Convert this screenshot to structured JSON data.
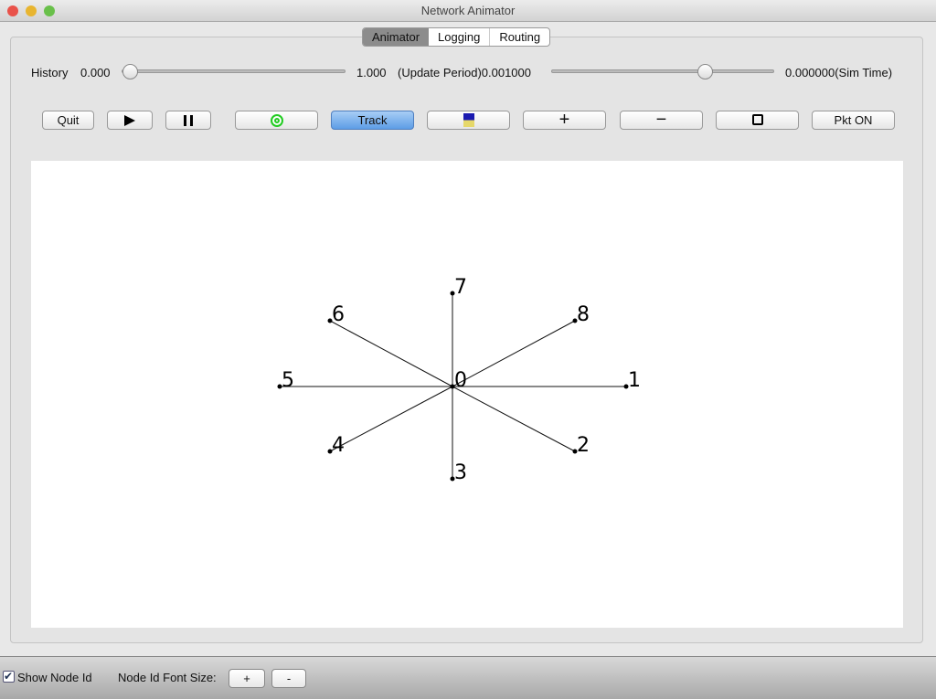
{
  "window": {
    "title": "Network Animator"
  },
  "tabs": [
    {
      "label": "Animator",
      "active": true
    },
    {
      "label": "Logging"
    },
    {
      "label": "Routing"
    }
  ],
  "controls": {
    "history_label": "History",
    "history_min": "0.000",
    "history_max": "1.000",
    "history_value": 0,
    "update_period_label": "(Update Period)0.001000",
    "update_period_value": 0.7,
    "sim_time": "0.000000(Sim Time)"
  },
  "toolbar": {
    "quit": "Quit",
    "play_icon": "play-icon",
    "pause_icon": "pause-icon",
    "ring_icon": "concentric-circles-icon",
    "track": "Track",
    "camera_icon": "camera-icon",
    "zoom_in": "+",
    "zoom_out": "−",
    "stop_icon": "square-icon",
    "pkt": "Pkt ON"
  },
  "network": {
    "nodes": [
      "0",
      "1",
      "2",
      "3",
      "4",
      "5",
      "6",
      "7",
      "8"
    ],
    "links": [
      [
        "0",
        "1"
      ],
      [
        "0",
        "2"
      ],
      [
        "0",
        "3"
      ],
      [
        "0",
        "4"
      ],
      [
        "0",
        "5"
      ],
      [
        "0",
        "6"
      ],
      [
        "0",
        "7"
      ],
      [
        "0",
        "8"
      ]
    ]
  },
  "bottom": {
    "show_node_id": "Show Node Id",
    "show_node_id_checked": true,
    "font_size_label": "Node Id Font Size:",
    "plus": "+",
    "minus": "-"
  }
}
